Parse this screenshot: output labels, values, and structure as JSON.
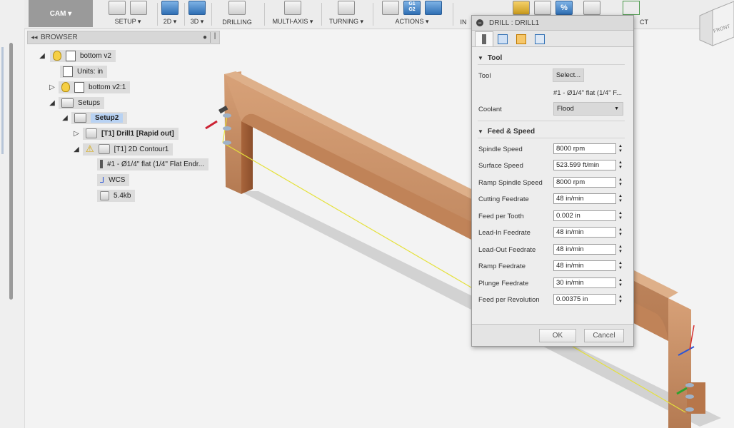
{
  "toolbar": {
    "workspace": "CAM ▾",
    "groups": [
      {
        "label": "SETUP ▾"
      },
      {
        "label": "2D ▾"
      },
      {
        "label": "3D ▾"
      },
      {
        "label": "DRILLING"
      },
      {
        "label": "MULTI-AXIS ▾"
      },
      {
        "label": "TURNING ▾"
      },
      {
        "label": "ACTIONS ▾"
      },
      {
        "label": "IN"
      },
      {
        "label": "CT"
      }
    ],
    "gcode_icon_text": [
      "G1",
      "G2"
    ],
    "percent_icon_text": "%"
  },
  "viewcube": {
    "label": "FRONT"
  },
  "browser": {
    "title": "BROWSER",
    "nodes": [
      {
        "label": "bottom v2"
      },
      {
        "label": "Units: in"
      },
      {
        "label": "bottom v2:1"
      },
      {
        "label": "Setups"
      },
      {
        "label": "Setup2"
      },
      {
        "label": "[T1] Drill1 [Rapid out]"
      },
      {
        "label": "[T1] 2D Contour1"
      },
      {
        "label": "#1 - Ø1/4\" flat (1/4\" Flat Endr..."
      },
      {
        "label": "WCS"
      },
      {
        "label": "5.4kb"
      }
    ]
  },
  "dialog": {
    "title": "DRILL : DRILL1",
    "tool_section": "Tool",
    "tool_label": "Tool",
    "select_button": "Select...",
    "tool_name": "#1 - Ø1/4\" flat (1/4\" F...",
    "coolant_label": "Coolant",
    "coolant_value": "Flood",
    "feed_section": "Feed & Speed",
    "params": [
      {
        "label": "Spindle Speed",
        "value": "8000 rpm"
      },
      {
        "label": "Surface Speed",
        "value": "523.599 ft/min"
      },
      {
        "label": "Ramp Spindle Speed",
        "value": "8000 rpm"
      },
      {
        "label": "Cutting Feedrate",
        "value": "48 in/min"
      },
      {
        "label": "Feed per Tooth",
        "value": "0.002 in"
      },
      {
        "label": "Lead-In Feedrate",
        "value": "48 in/min"
      },
      {
        "label": "Lead-Out Feedrate",
        "value": "48 in/min"
      },
      {
        "label": "Ramp Feedrate",
        "value": "48 in/min"
      },
      {
        "label": "Plunge Feedrate",
        "value": "30 in/min"
      },
      {
        "label": "Feed per Revolution",
        "value": "0.00375 in"
      }
    ],
    "ok": "OK",
    "cancel": "Cancel"
  }
}
